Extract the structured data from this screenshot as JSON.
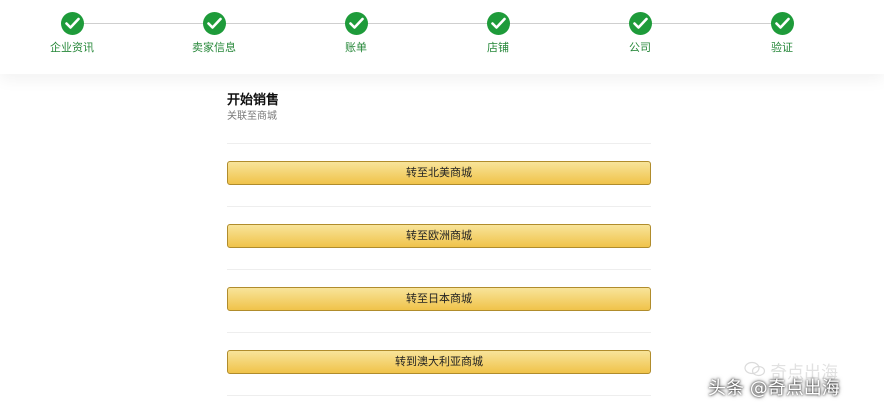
{
  "stepper": {
    "steps": [
      {
        "label": "企业资讯",
        "status": "complete"
      },
      {
        "label": "卖家信息",
        "status": "complete"
      },
      {
        "label": "账单",
        "status": "complete"
      },
      {
        "label": "店铺",
        "status": "complete"
      },
      {
        "label": "公司",
        "status": "complete"
      },
      {
        "label": "验证",
        "status": "complete"
      }
    ],
    "check_color": "#1e9b3a",
    "label_color": "#27883a"
  },
  "main": {
    "title": "开始销售",
    "subtitle": "关联至商城",
    "buttons": [
      {
        "label": "转至北美商城"
      },
      {
        "label": "转至欧洲商城"
      },
      {
        "label": "转至日本商城"
      },
      {
        "label": "转到澳大利亚商城"
      }
    ],
    "button_color": "#f0c34a"
  },
  "watermark": {
    "account_name": "奇点出海",
    "platform_credit": "头条 @奇点出海",
    "logo_icon": "wechat-logo-icon"
  }
}
